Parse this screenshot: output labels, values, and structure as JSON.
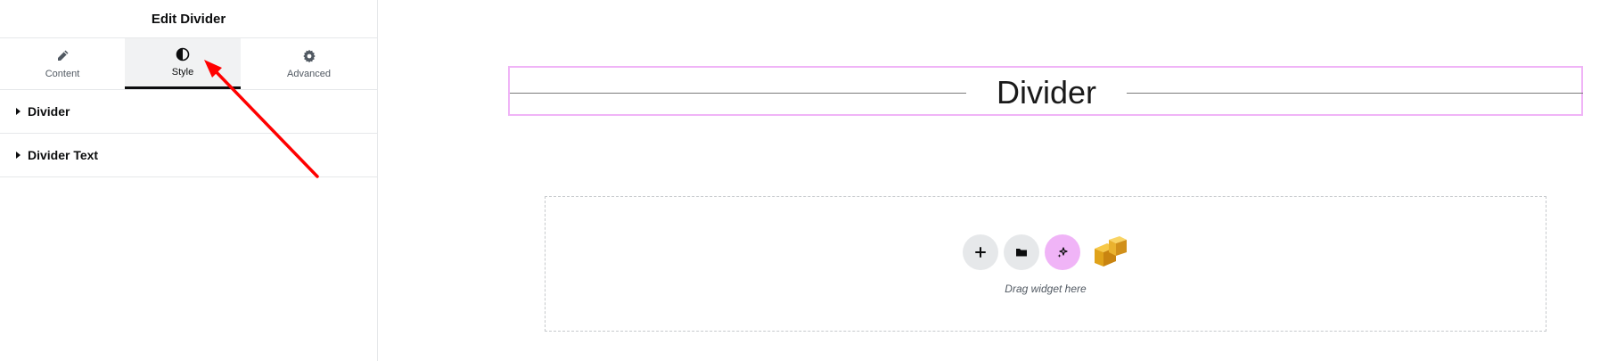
{
  "panel": {
    "title": "Edit Divider",
    "tabs": [
      {
        "label": "Content",
        "icon": "pencil-icon",
        "active": false
      },
      {
        "label": "Style",
        "icon": "half-circle-contrast-icon",
        "active": true
      },
      {
        "label": "Advanced",
        "icon": "gear-icon",
        "active": false
      }
    ],
    "sections": [
      {
        "label": "Divider"
      },
      {
        "label": "Divider Text"
      }
    ]
  },
  "canvas": {
    "divider_widget": {
      "text": "Divider"
    },
    "dropzone": {
      "label": "Drag widget here",
      "buttons": [
        "plus-icon",
        "folder-icon",
        "ai-sparkle-icon",
        "template-kit-cube-icon"
      ]
    }
  },
  "colors": {
    "accent_pink": "#f0b4f7",
    "annotation_arrow": "#ff0000",
    "active_tab_bg": "#f1f2f3"
  }
}
